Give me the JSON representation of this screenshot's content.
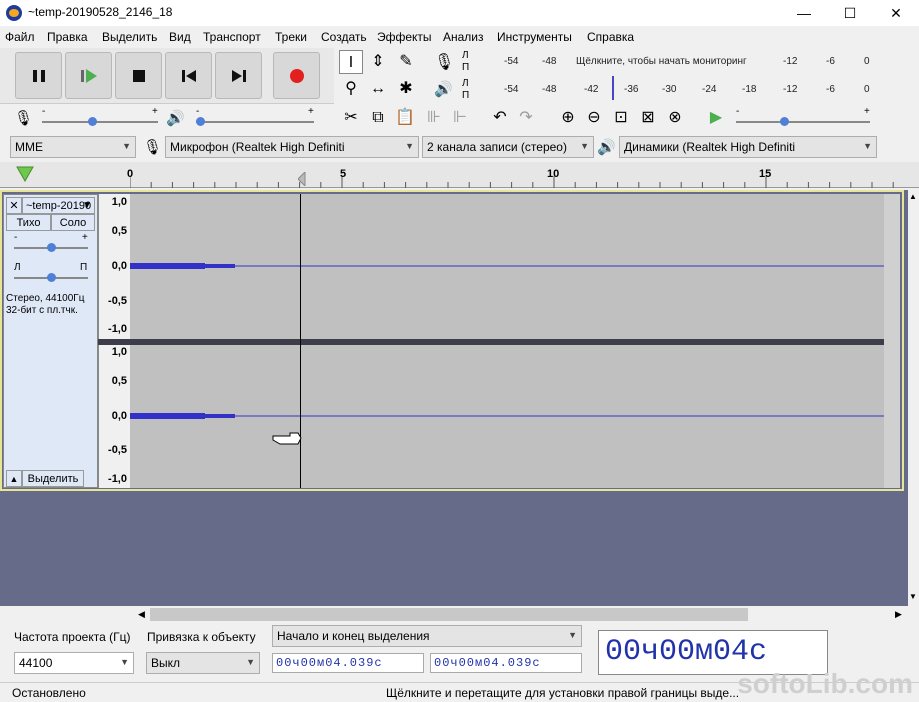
{
  "window": {
    "title": "~temp-20190528_2146_18",
    "minimize": "—",
    "maximize": "☐",
    "close": "✕"
  },
  "menu": [
    "Файл",
    "Правка",
    "Выделить",
    "Вид",
    "Транспорт",
    "Треки",
    "Создать",
    "Эффекты",
    "Анализ",
    "Инструменты",
    "Справка"
  ],
  "transport": {
    "pause": "pause-icon",
    "play": "play-icon",
    "stop": "stop-icon",
    "skip_start": "skip-start-icon",
    "skip_end": "skip-end-icon",
    "record": "record-icon"
  },
  "meters": {
    "rec_channels": [
      "Л",
      "П"
    ],
    "rec_ticks": [
      "-54",
      "-48",
      "-12",
      "-6",
      "0"
    ],
    "rec_prompt": "Щёлкните, чтобы начать мониторинг",
    "play_channels": [
      "Л",
      "П"
    ],
    "play_ticks": [
      "-54",
      "-48",
      "-42",
      "-36",
      "-30",
      "-24",
      "-18",
      "-12",
      "-6",
      "0"
    ]
  },
  "mixer": {
    "minus": "-",
    "plus": "+"
  },
  "devices": {
    "host": "MME",
    "mic": "Микрофон (Realtek High Definiti",
    "channels": "2 канала записи (стерео)",
    "speakers": "Динамики (Realtek High Definiti"
  },
  "ruler": [
    "0",
    "5",
    "10",
    "15"
  ],
  "track": {
    "name": "~temp-20190",
    "mute": "Тихо",
    "solo": "Соло",
    "gain_minus": "-",
    "gain_plus": "+",
    "pan_left": "Л",
    "pan_right": "П",
    "info_line1": "Стерео, 44100Гц",
    "info_line2": "32-бит с пл.тчк.",
    "select": "Выделить",
    "close": "✕",
    "collapse": "▲",
    "menu_arrow": "▼",
    "yaxis": [
      "1,0",
      "0,5",
      "0,0",
      "-0,5",
      "-1,0"
    ]
  },
  "selection_bar": {
    "rate_label": "Частота проекта (Гц)",
    "rate_value": "44100",
    "snap_label": "Привязка к объекту",
    "snap_value": "Выкл",
    "range_label": "Начало и конец выделения",
    "start_time": "00ч00м04.039с",
    "end_time": "00ч00м04.039с",
    "audio_pos": "00ч00м04с"
  },
  "status": {
    "left": "Остановлено",
    "right": "Щёлкните и перетащите для установки правой границы выде..."
  },
  "watermark": "softoLib.com",
  "colors": {
    "waveform": "#3232c8",
    "background": "#666b8a",
    "track_bg": "#c0c0c0",
    "record_red": "#e32020"
  }
}
